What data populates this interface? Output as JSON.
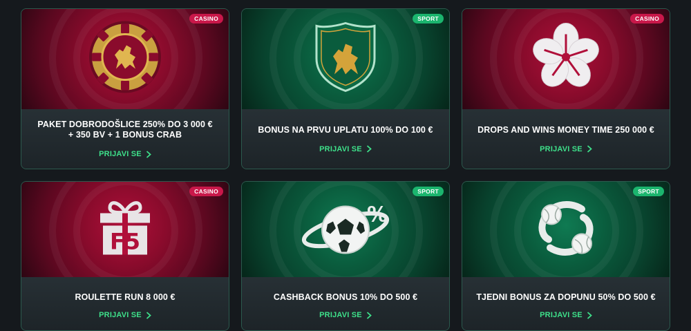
{
  "cards": [
    {
      "badge": "CASINO",
      "type": "casino",
      "title": "PAKET DOBRODOŠLICE 250% DO 3 000 € + 350 BV + 1 BONUS CRAB",
      "cta": "PRIJAVI SE",
      "icon": "lion-chip-icon"
    },
    {
      "badge": "SPORT",
      "type": "sport",
      "title": "BONUS NA PRVU UPLATU 100% DO 100 €",
      "cta": "PRIJAVI SE",
      "icon": "lion-shield-icon"
    },
    {
      "badge": "CASINO",
      "type": "casino",
      "title": "DROPS AND WINS MONEY TIME 250 000 €",
      "cta": "PRIJAVI SE",
      "icon": "flower-icon"
    },
    {
      "badge": "CASINO",
      "type": "casino",
      "title": "ROULETTE RUN 8 000 €",
      "cta": "PRIJAVI SE",
      "icon": "gift-fs-icon"
    },
    {
      "badge": "SPORT",
      "type": "sport",
      "title": "CASHBACK BONUS 10% DO 500 €",
      "cta": "PRIJAVI SE",
      "icon": "football-percent-icon"
    },
    {
      "badge": "SPORT",
      "type": "sport",
      "title": "TJEDNI BONUS ZA DOPUNU 50% DO 500 €",
      "cta": "PRIJAVI SE",
      "icon": "balls-cycle-icon"
    }
  ],
  "colors": {
    "background": "#15191d",
    "casino_red": "#c9184a",
    "sport_green": "#1bb56e",
    "cta_green": "#3ee08a",
    "gold": "#d4a33a"
  }
}
